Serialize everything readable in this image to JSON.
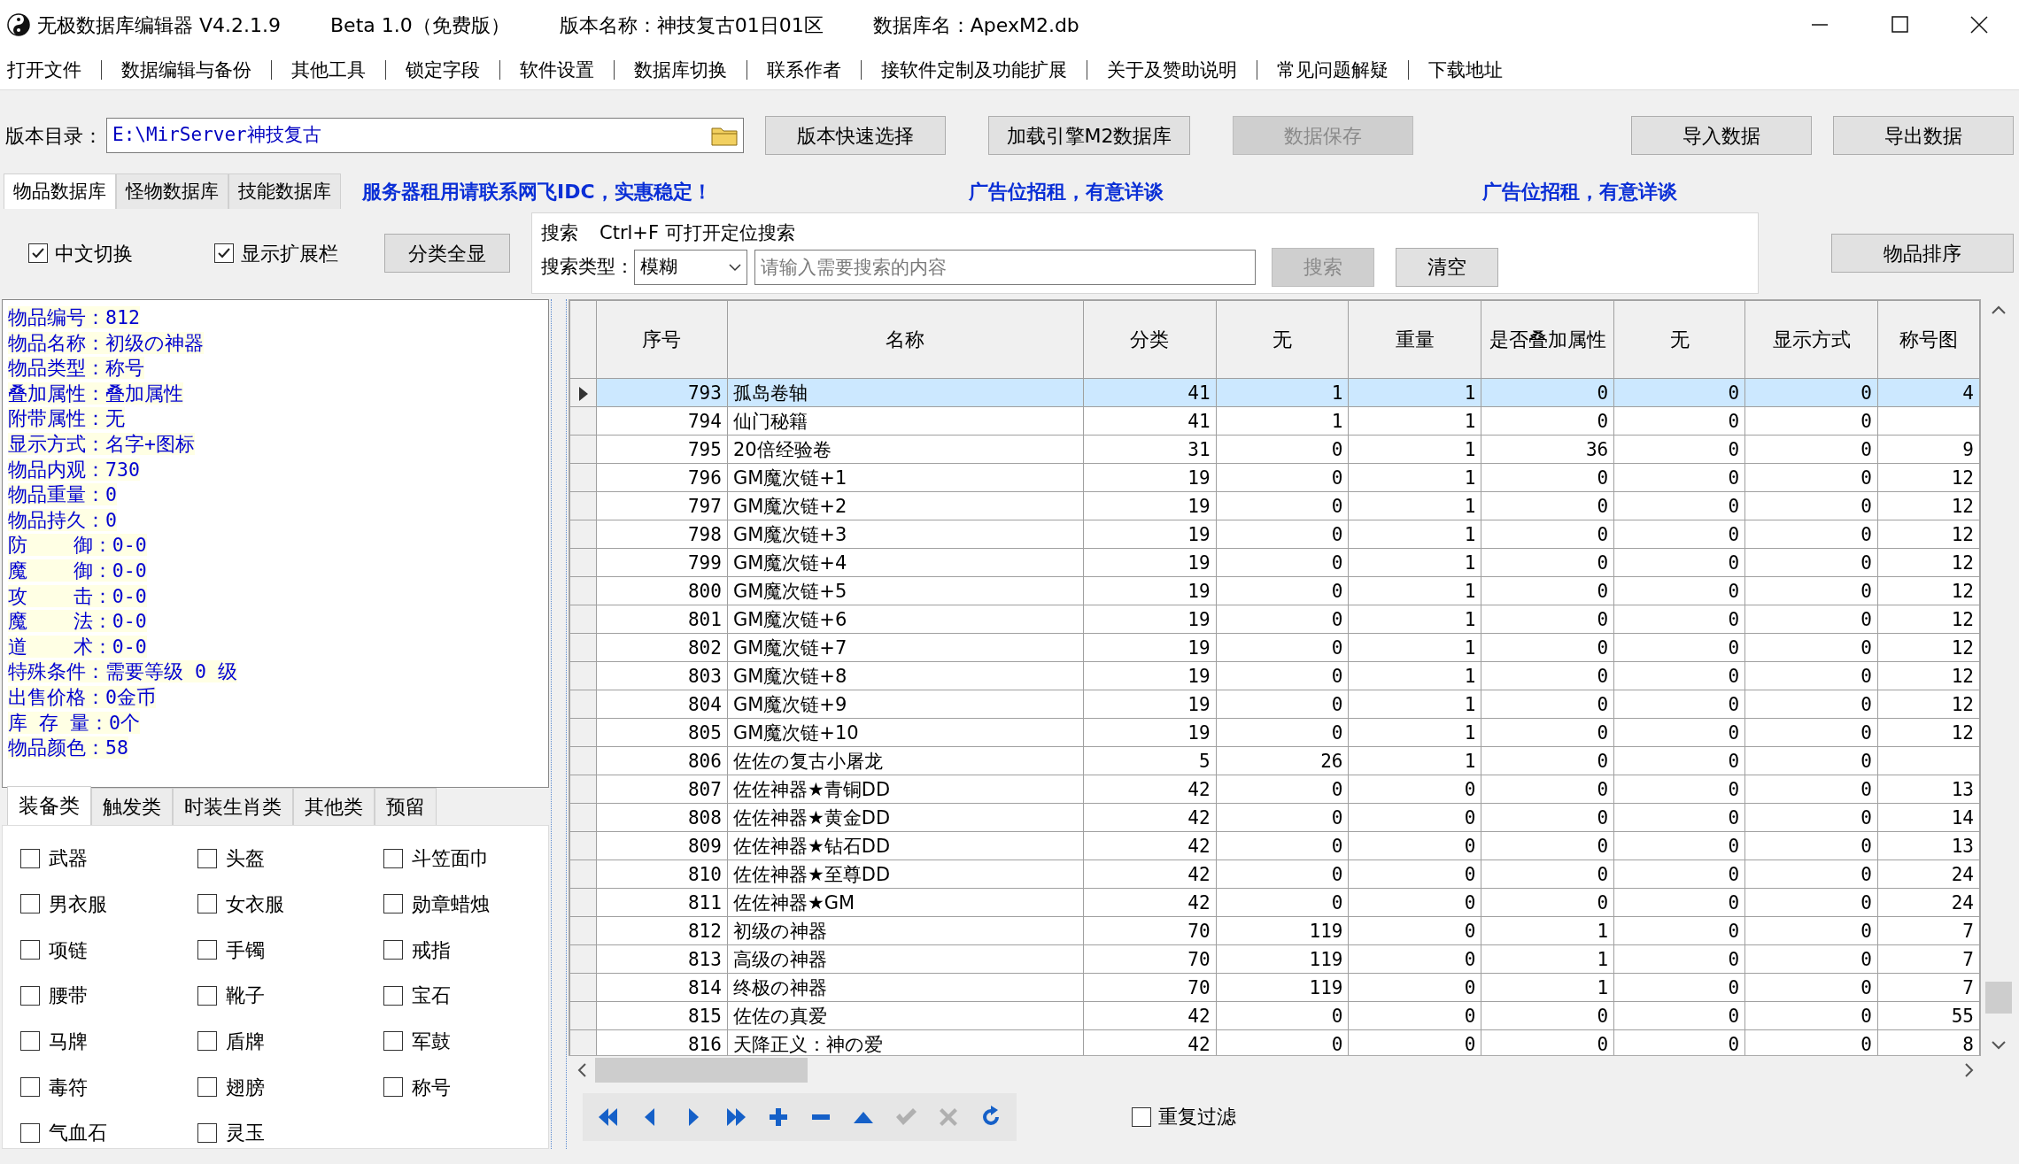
{
  "window": {
    "title_parts": [
      "无极数据库编辑器 V4.2.1.9",
      "Beta 1.0（免费版）",
      "版本名称：神技复古01日01区",
      "数据库名：ApexM2.db"
    ]
  },
  "menu": [
    "打开文件",
    "数据编辑与备份",
    "其他工具",
    "锁定字段",
    "软件设置",
    "数据库切换",
    "联系作者",
    "接软件定制及功能扩展",
    "关于及赞助说明",
    "常见问题解疑",
    "下载地址"
  ],
  "path_bar": {
    "label": "版本目录：",
    "value": "E:\\MirServer神技复古",
    "buttons": [
      {
        "label": "版本快速选择",
        "disabled": false
      },
      {
        "label": "加载引擎M2数据库",
        "disabled": false
      },
      {
        "label": "数据保存",
        "disabled": true
      }
    ],
    "right_buttons": [
      {
        "label": "导入数据",
        "disabled": false
      },
      {
        "label": "导出数据",
        "disabled": false
      }
    ]
  },
  "db_tabs": [
    {
      "label": "物品数据库",
      "selected": true
    },
    {
      "label": "怪物数据库",
      "selected": false
    },
    {
      "label": "技能数据库",
      "selected": false
    }
  ],
  "ads": [
    "服务器租用请联系网飞IDC，实惠稳定！",
    "广告位招租，有意详谈",
    "广告位招租，有意详谈"
  ],
  "options": [
    {
      "label": "中文切换",
      "checked": true
    },
    {
      "label": "显示扩展栏",
      "checked": true
    }
  ],
  "show_all_button": "分类全显",
  "search": {
    "title": "搜索",
    "hint": "Ctrl+F 可打开定位搜索",
    "type_label": "搜索类型：",
    "type_value": "模糊",
    "placeholder": "请输入需要搜索的内容",
    "buttons": [
      {
        "label": "搜索",
        "disabled": true
      },
      {
        "label": "清空",
        "disabled": false
      }
    ]
  },
  "sort_button": "物品排序",
  "info_lines": [
    "物品编号：812",
    "物品名称：初级の神器",
    "物品类型：称号",
    "叠加属性：叠加属性",
    "附带属性：无",
    "显示方式：名字+图标",
    "物品内观：730",
    "物品重量：0",
    "物品持久：0",
    "防    御：0-0",
    "魔    御：0-0",
    "攻    击：0-0",
    "魔    法：0-0",
    "道    术：0-0",
    "特殊条件：需要等级 0 级",
    "出售价格：0金币",
    "库 存 量：0个",
    "物品颜色：58"
  ],
  "category_tabs": [
    {
      "label": "装备类",
      "selected": true
    },
    {
      "label": "触发类",
      "selected": false
    },
    {
      "label": "时装生肖类",
      "selected": false
    },
    {
      "label": "其他类",
      "selected": false
    },
    {
      "label": "预留",
      "selected": false
    }
  ],
  "categories": [
    {
      "label": "武器",
      "checked": false
    },
    {
      "label": "头盔",
      "checked": false
    },
    {
      "label": "斗笠面巾",
      "checked": false
    },
    {
      "label": "男衣服",
      "checked": false
    },
    {
      "label": "女衣服",
      "checked": false
    },
    {
      "label": "勋章蜡烛",
      "checked": false
    },
    {
      "label": "项链",
      "checked": false
    },
    {
      "label": "手镯",
      "checked": false
    },
    {
      "label": "戒指",
      "checked": false
    },
    {
      "label": "腰带",
      "checked": false
    },
    {
      "label": "靴子",
      "checked": false
    },
    {
      "label": "宝石",
      "checked": false
    },
    {
      "label": "马牌",
      "checked": false
    },
    {
      "label": "盾牌",
      "checked": false
    },
    {
      "label": "军鼓",
      "checked": false
    },
    {
      "label": "毒符",
      "checked": false
    },
    {
      "label": "翅膀",
      "checked": false
    },
    {
      "label": "称号",
      "checked": false
    },
    {
      "label": "气血石",
      "checked": false
    },
    {
      "label": "灵玉",
      "checked": false
    }
  ],
  "table": {
    "columns": [
      "序号",
      "名称",
      "分类",
      "无",
      "重量",
      "是否叠加属性",
      "无",
      "显示方式",
      "称号图"
    ],
    "rows": [
      {
        "selected": true,
        "cells": [
          "793",
          "孤岛卷轴",
          "41",
          "1",
          "1",
          "0",
          "0",
          "0",
          "4"
        ]
      },
      {
        "selected": false,
        "cells": [
          "794",
          "仙门秘籍",
          "41",
          "1",
          "1",
          "0",
          "0",
          "0",
          null
        ]
      },
      {
        "selected": false,
        "cells": [
          "795",
          "20倍经验卷",
          "31",
          "0",
          "1",
          "36",
          "0",
          "0",
          "9"
        ]
      },
      {
        "selected": false,
        "cells": [
          "796",
          "GM魔次链+1",
          "19",
          "0",
          "1",
          "0",
          "0",
          "0",
          "12"
        ]
      },
      {
        "selected": false,
        "cells": [
          "797",
          "GM魔次链+2",
          "19",
          "0",
          "1",
          "0",
          "0",
          "0",
          "12"
        ]
      },
      {
        "selected": false,
        "cells": [
          "798",
          "GM魔次链+3",
          "19",
          "0",
          "1",
          "0",
          "0",
          "0",
          "12"
        ]
      },
      {
        "selected": false,
        "cells": [
          "799",
          "GM魔次链+4",
          "19",
          "0",
          "1",
          "0",
          "0",
          "0",
          "12"
        ]
      },
      {
        "selected": false,
        "cells": [
          "800",
          "GM魔次链+5",
          "19",
          "0",
          "1",
          "0",
          "0",
          "0",
          "12"
        ]
      },
      {
        "selected": false,
        "cells": [
          "801",
          "GM魔次链+6",
          "19",
          "0",
          "1",
          "0",
          "0",
          "0",
          "12"
        ]
      },
      {
        "selected": false,
        "cells": [
          "802",
          "GM魔次链+7",
          "19",
          "0",
          "1",
          "0",
          "0",
          "0",
          "12"
        ]
      },
      {
        "selected": false,
        "cells": [
          "803",
          "GM魔次链+8",
          "19",
          "0",
          "1",
          "0",
          "0",
          "0",
          "12"
        ]
      },
      {
        "selected": false,
        "cells": [
          "804",
          "GM魔次链+9",
          "19",
          "0",
          "1",
          "0",
          "0",
          "0",
          "12"
        ]
      },
      {
        "selected": false,
        "cells": [
          "805",
          "GM魔次链+10",
          "19",
          "0",
          "1",
          "0",
          "0",
          "0",
          "12"
        ]
      },
      {
        "selected": false,
        "cells": [
          "806",
          "佐佐の复古小屠龙",
          "5",
          "26",
          "1",
          "0",
          "0",
          "0",
          null
        ]
      },
      {
        "selected": false,
        "cells": [
          "807",
          "佐佐神器★青铜DD",
          "42",
          "0",
          "0",
          "0",
          "0",
          "0",
          "13"
        ]
      },
      {
        "selected": false,
        "cells": [
          "808",
          "佐佐神器★黄金DD",
          "42",
          "0",
          "0",
          "0",
          "0",
          "0",
          "14"
        ]
      },
      {
        "selected": false,
        "cells": [
          "809",
          "佐佐神器★钻石DD",
          "42",
          "0",
          "0",
          "0",
          "0",
          "0",
          "13"
        ]
      },
      {
        "selected": false,
        "cells": [
          "810",
          "佐佐神器★至尊DD",
          "42",
          "0",
          "0",
          "0",
          "0",
          "0",
          "24"
        ]
      },
      {
        "selected": false,
        "cells": [
          "811",
          "佐佐神器★GM",
          "42",
          "0",
          "0",
          "0",
          "0",
          "0",
          "24"
        ]
      },
      {
        "selected": false,
        "cells": [
          "812",
          "初级の神器",
          "70",
          "119",
          "0",
          "1",
          "0",
          "0",
          "7"
        ]
      },
      {
        "selected": false,
        "cells": [
          "813",
          "高级の神器",
          "70",
          "119",
          "0",
          "1",
          "0",
          "0",
          "7"
        ]
      },
      {
        "selected": false,
        "cells": [
          "814",
          "终极の神器",
          "70",
          "119",
          "0",
          "1",
          "0",
          "0",
          "7"
        ]
      },
      {
        "selected": false,
        "cells": [
          "815",
          "佐佐の真爱",
          "42",
          "0",
          "0",
          "0",
          "0",
          "0",
          "55"
        ]
      },
      {
        "selected": false,
        "cells": [
          "816",
          "天降正义：神の爱",
          "42",
          "0",
          "0",
          "0",
          "0",
          "0",
          "8"
        ]
      }
    ]
  },
  "navigator": [
    {
      "kind": "first",
      "disabled": false
    },
    {
      "kind": "prior",
      "disabled": false
    },
    {
      "kind": "next",
      "disabled": false
    },
    {
      "kind": "last",
      "disabled": false
    },
    {
      "kind": "insert",
      "disabled": false
    },
    {
      "kind": "delete",
      "disabled": false
    },
    {
      "kind": "edit",
      "disabled": false
    },
    {
      "kind": "post",
      "disabled": true
    },
    {
      "kind": "cancel",
      "disabled": true
    },
    {
      "kind": "refresh",
      "disabled": false
    }
  ],
  "filter": {
    "label": "重复过滤",
    "checked": false
  }
}
